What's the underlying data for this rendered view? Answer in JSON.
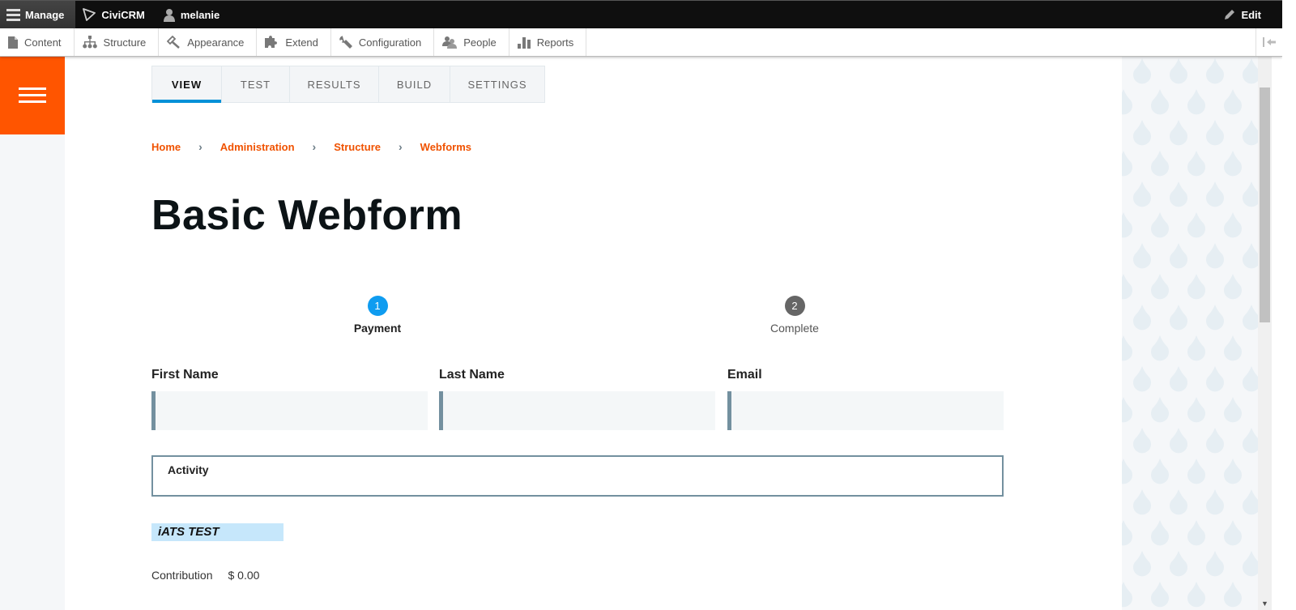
{
  "toolbar": {
    "manage_label": "Manage",
    "civicrm_label": "CiviCRM",
    "user_label": "melanie",
    "edit_label": "Edit"
  },
  "tray": {
    "items": [
      {
        "label": "Content",
        "icon": "document-icon"
      },
      {
        "label": "Structure",
        "icon": "sitemap-icon"
      },
      {
        "label": "Appearance",
        "icon": "paintbrush-icon"
      },
      {
        "label": "Extend",
        "icon": "puzzle-icon"
      },
      {
        "label": "Configuration",
        "icon": "wrench-icon"
      },
      {
        "label": "People",
        "icon": "people-icon"
      },
      {
        "label": "Reports",
        "icon": "bar-chart-icon"
      }
    ]
  },
  "tabs": [
    {
      "label": "VIEW",
      "active": true
    },
    {
      "label": "TEST",
      "active": false
    },
    {
      "label": "RESULTS",
      "active": false
    },
    {
      "label": "BUILD",
      "active": false
    },
    {
      "label": "SETTINGS",
      "active": false
    }
  ],
  "breadcrumb": [
    "Home",
    "Administration",
    "Structure",
    "Webforms"
  ],
  "breadcrumb_separator": "›",
  "page_title": "Basic Webform",
  "progress": {
    "steps": [
      {
        "number": "1",
        "label": "Payment",
        "current": true
      },
      {
        "number": "2",
        "label": "Complete",
        "current": false
      }
    ]
  },
  "form": {
    "first_name": {
      "label": "First Name",
      "value": ""
    },
    "last_name": {
      "label": "Last Name",
      "value": ""
    },
    "email": {
      "label": "Email",
      "value": ""
    },
    "activity_label": "Activity",
    "section_heading": "iATS TEST",
    "contribution_label": "Contribution",
    "contribution_value": "$ 0.00"
  },
  "colors": {
    "accent_orange": "#ff5500",
    "breadcrumb_link": "#f05200",
    "tab_active_underline": "#0591d8",
    "step_current": "#0f9cf0",
    "step_upcoming": "#666666",
    "input_border": "#73909f",
    "section_highlight": "#c6e7fb"
  }
}
